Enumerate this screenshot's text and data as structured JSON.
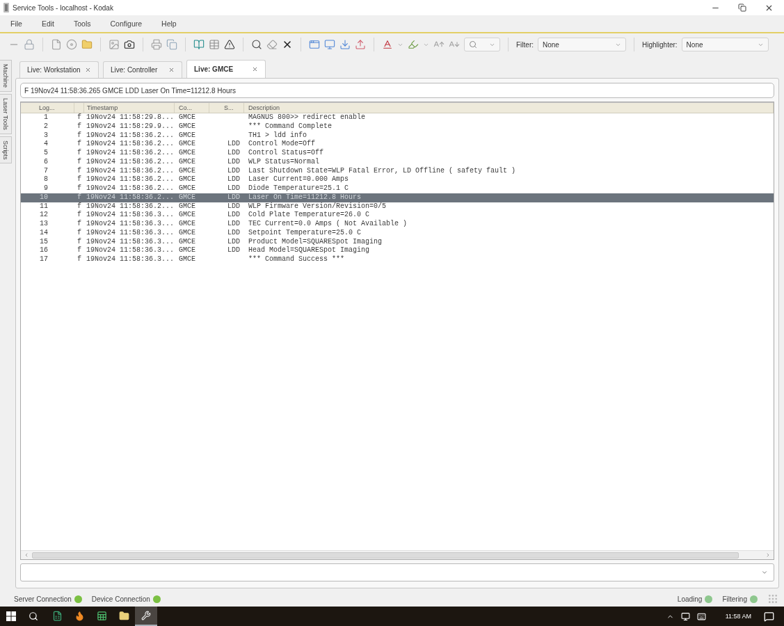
{
  "window": {
    "title": "Service Tools - localhost - Kodak"
  },
  "menu": [
    "File",
    "Edit",
    "Tools",
    "Configure",
    "Help"
  ],
  "toolbar": {
    "filter": {
      "label": "Filter:",
      "value": "None"
    },
    "highlighter": {
      "label": "Highlighter:",
      "value": "None"
    }
  },
  "side_tabs": [
    {
      "label": "Machine",
      "selected": false
    },
    {
      "label": "Laser Tools",
      "selected": false
    },
    {
      "label": "Scripts",
      "selected": false
    }
  ],
  "tabs": [
    {
      "label": "Live: Workstation",
      "selected": false
    },
    {
      "label": "Live: Controller",
      "selected": false
    },
    {
      "label": "Live: GMCE",
      "selected": true
    }
  ],
  "info_line": "F 19Nov24 11:58:36.265 GMCE LDD Laser On Time=11212.8 Hours",
  "table": {
    "columns": {
      "log": "Log...",
      "timestamp": "Timestamp",
      "column_4": "Co...",
      "column_5": "S...",
      "description": "Description"
    },
    "rows": [
      {
        "log": "1",
        "column_2": "f",
        "timestamp": "19Nov24 11:58:29.8...",
        "column_4": "GMCE",
        "description": "MAGNUS 800>> redirect enable",
        "selected": false
      },
      {
        "log": "2",
        "column_2": "f",
        "timestamp": "19Nov24 11:58:29.9...",
        "column_4": "GMCE",
        "description": "*** Command Complete",
        "selected": false
      },
      {
        "log": "3",
        "column_2": "f",
        "timestamp": "19Nov24 11:58:36.2...",
        "column_4": "GMCE",
        "description": "TH1 > ldd info",
        "selected": false
      },
      {
        "log": "4",
        "column_2": "f",
        "timestamp": "19Nov24 11:58:36.2...",
        "column_4": "GMCE",
        "column_5": "LDD",
        "description": "Control Mode=Off",
        "selected": false
      },
      {
        "log": "5",
        "column_2": "f",
        "timestamp": "19Nov24 11:58:36.2...",
        "column_4": "GMCE",
        "column_5": "LDD",
        "description": "Control Status=Off",
        "selected": false
      },
      {
        "log": "6",
        "column_2": "f",
        "timestamp": "19Nov24 11:58:36.2...",
        "column_4": "GMCE",
        "column_5": "LDD",
        "description": "WLP Status=Normal",
        "selected": false
      },
      {
        "log": "7",
        "column_2": "f",
        "timestamp": "19Nov24 11:58:36.2...",
        "column_4": "GMCE",
        "column_5": "LDD",
        "description": "Last Shutdown State=WLP Fatal Error, LD Offline ( safety fault )",
        "selected": false
      },
      {
        "log": "8",
        "column_2": "f",
        "timestamp": "19Nov24 11:58:36.2...",
        "column_4": "GMCE",
        "column_5": "LDD",
        "description": "Laser Current=0.000 Amps",
        "selected": false
      },
      {
        "log": "9",
        "column_2": "f",
        "timestamp": "19Nov24 11:58:36.2...",
        "column_4": "GMCE",
        "column_5": "LDD",
        "description": "Diode Temperature=25.1 C",
        "selected": false
      },
      {
        "log": "10",
        "column_2": "f",
        "timestamp": "19Nov24 11:58:36.2...",
        "column_4": "GMCE",
        "column_5": "LDD",
        "description": "Laser On Time=11212.8 Hours",
        "selected": true
      },
      {
        "log": "11",
        "column_2": "f",
        "timestamp": "19Nov24 11:58:36.2...",
        "column_4": "GMCE",
        "column_5": "LDD",
        "description": "WLP Firmware Version/Revision=0/5",
        "selected": false
      },
      {
        "log": "12",
        "column_2": "f",
        "timestamp": "19Nov24 11:58:36.3...",
        "column_4": "GMCE",
        "column_5": "LDD",
        "description": "Cold Plate Temperature=26.0 C",
        "selected": false
      },
      {
        "log": "13",
        "column_2": "f",
        "timestamp": "19Nov24 11:58:36.3...",
        "column_4": "GMCE",
        "column_5": "LDD",
        "description": "TEC Current=0.0 Amps ( Not Available )",
        "selected": false
      },
      {
        "log": "14",
        "column_2": "f",
        "timestamp": "19Nov24 11:58:36.3...",
        "column_4": "GMCE",
        "column_5": "LDD",
        "description": "Setpoint Temperature=25.0 C",
        "selected": false
      },
      {
        "log": "15",
        "column_2": "f",
        "timestamp": "19Nov24 11:58:36.3...",
        "column_4": "GMCE",
        "column_5": "LDD",
        "description": "Product Model=SQUARESpot Imaging",
        "selected": false
      },
      {
        "log": "16",
        "column_2": "f",
        "timestamp": "19Nov24 11:58:36.3...",
        "column_4": "GMCE",
        "column_5": "LDD",
        "description": "Head Model=SQUARESpot Imaging",
        "selected": false
      },
      {
        "log": "17",
        "column_2": "f",
        "timestamp": "19Nov24 11:58:36.3...",
        "column_4": "GMCE",
        "description": "*** Command Success ***",
        "selected": false
      }
    ]
  },
  "status_bar": {
    "left": [
      {
        "label": "Server Connection",
        "color": "#7bc043"
      },
      {
        "label": "Device Connection",
        "color": "#7bc043"
      }
    ],
    "right": [
      {
        "label": "Loading",
        "color": "#8ec78e"
      },
      {
        "label": "Filtering",
        "color": "#8ec78e"
      }
    ]
  },
  "taskbar": {
    "apps": [
      {
        "kind": "spreadsheet",
        "selected": false
      },
      {
        "kind": "flame",
        "selected": false
      },
      {
        "kind": "sheet",
        "selected": false
      },
      {
        "kind": "folder",
        "selected": false
      },
      {
        "kind": "wrench",
        "selected": true
      }
    ],
    "clock": "11:58 AM"
  }
}
